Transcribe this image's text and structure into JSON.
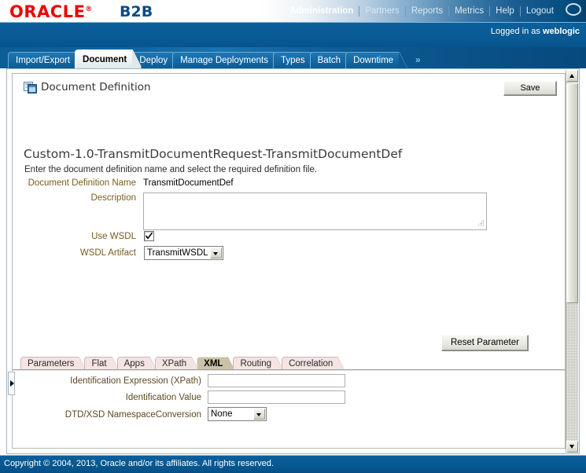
{
  "brand": {
    "logo": "ORACLE",
    "tm": "®",
    "product": "B2B"
  },
  "global_nav": {
    "items": [
      {
        "label": "Administration",
        "active": true
      },
      {
        "label": "Partners",
        "active": false
      },
      {
        "label": "Reports",
        "active": false
      },
      {
        "label": "Metrics",
        "active": false
      },
      {
        "label": "Help",
        "active": false
      },
      {
        "label": "Logout",
        "active": false
      }
    ],
    "user_icon": "user-avatar-icon"
  },
  "session": {
    "logged_in_prefix": "Logged in as ",
    "username": "weblogic"
  },
  "primary_tabs": {
    "items": [
      {
        "label": "Import/Export",
        "active": false
      },
      {
        "label": "Document",
        "active": true
      },
      {
        "label": "Deploy",
        "active": false
      },
      {
        "label": "Manage Deployments",
        "active": false
      },
      {
        "label": "Types",
        "active": false
      },
      {
        "label": "Batch",
        "active": false
      },
      {
        "label": "Downtime",
        "active": false
      }
    ],
    "overflow": "»"
  },
  "panel": {
    "icon": "document-definition-icon",
    "title": "Document Definition",
    "save_label": "Save"
  },
  "form": {
    "heading": "Custom-1.0-TransmitDocumentRequest-TransmitDocumentDef",
    "instruction": "Enter the document definition name and select the required definition file.",
    "fields": {
      "doc_def_name_label": "Document Definition Name",
      "doc_def_name_value": "TransmitDocumentDef",
      "description_label": "Description",
      "description_value": "",
      "description_placeholder": "",
      "use_wsdl_label": "Use WSDL",
      "use_wsdl_checked": true,
      "wsdl_artifact_label": "WSDL Artifact",
      "wsdl_artifact_value": "TransmitWSDL",
      "wsdl_artifact_options": [
        "TransmitWSDL"
      ]
    },
    "reset_label": "Reset Parameter"
  },
  "sub_tabs": {
    "items": [
      {
        "label": "Parameters",
        "active": false
      },
      {
        "label": "Flat",
        "active": false
      },
      {
        "label": "Apps",
        "active": false
      },
      {
        "label": "XPath",
        "active": false
      },
      {
        "label": "XML",
        "active": true
      },
      {
        "label": "Routing",
        "active": false
      },
      {
        "label": "Correlation",
        "active": false
      }
    ]
  },
  "xml_panel": {
    "ident_expr_label": "Identification Expression (XPath)",
    "ident_expr_value": "",
    "ident_value_label": "Identification Value",
    "ident_value_value": "",
    "namespace_label": "DTD/XSD NamespaceConversion",
    "namespace_value": "None",
    "namespace_options": [
      "None"
    ]
  },
  "footer": {
    "text": "Copyright © 2004, 2013, Oracle and/or its affiliates.  All rights reserved."
  },
  "colors": {
    "oracle_red": "#f00000",
    "product_blue": "#0a4b84",
    "header_blue": "#0a5f9b",
    "label_brown": "#7a5c20",
    "active_subtab": "#cbc3a8"
  }
}
